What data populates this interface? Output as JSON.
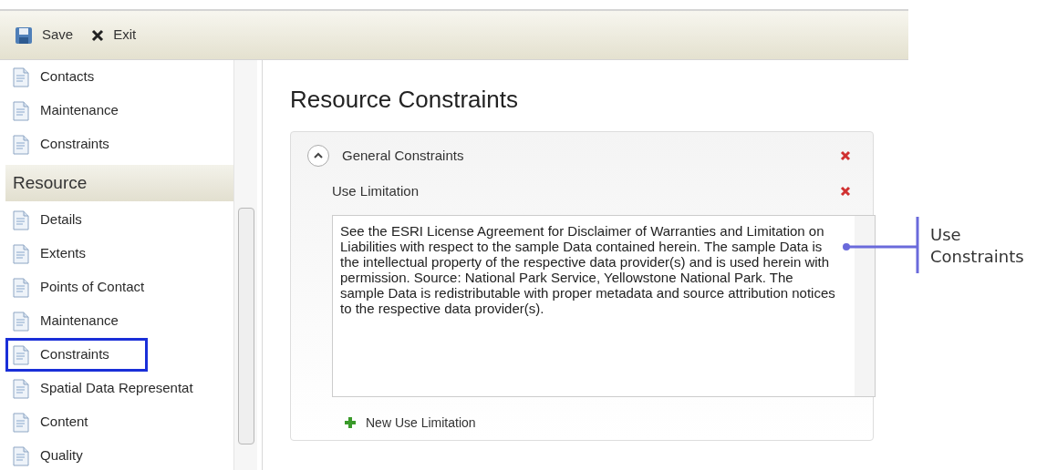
{
  "toolbar": {
    "buttons": [
      {
        "kind": "save",
        "label": "Save"
      },
      {
        "kind": "exit",
        "label": "Exit"
      }
    ]
  },
  "sidebar": {
    "items": [
      {
        "kind": "item",
        "label": "Contacts",
        "selected": false
      },
      {
        "kind": "item",
        "label": "Maintenance",
        "selected": false
      },
      {
        "kind": "item",
        "label": "Constraints",
        "selected": false
      },
      {
        "kind": "header",
        "label": "Resource"
      },
      {
        "kind": "item",
        "label": "Details",
        "selected": false
      },
      {
        "kind": "item",
        "label": "Extents",
        "selected": false
      },
      {
        "kind": "item",
        "label": "Points of Contact",
        "selected": false
      },
      {
        "kind": "item",
        "label": "Maintenance",
        "selected": false
      },
      {
        "kind": "item",
        "label": "Constraints",
        "selected": true
      },
      {
        "kind": "item",
        "label": "Spatial Data Representat",
        "selected": false
      },
      {
        "kind": "item",
        "label": "Content",
        "selected": false
      },
      {
        "kind": "item",
        "label": "Quality",
        "selected": false
      }
    ]
  },
  "page": {
    "title": "Resource Constraints",
    "section": {
      "title": "General Constraints",
      "expanded": true,
      "field": {
        "label": "Use Limitation",
        "value": "See the ESRI License Agreement for Disclaimer of Warranties and Limitation on Liabilities with respect to the sample Data contained herein. The sample Data is the intellectual property of the respective data provider(s) and is used herein with permission. Source: National Park Service, Yellowstone National Park. The sample Data is redistributable with proper metadata and source attribution notices to the respective data provider(s)."
      },
      "add_button": "New Use Limitation"
    }
  },
  "annotation": {
    "label": "Use Constraints"
  }
}
